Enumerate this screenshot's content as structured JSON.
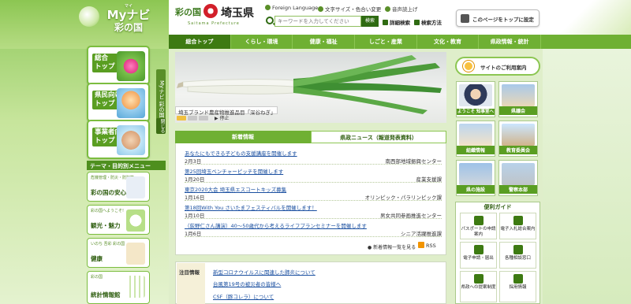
{
  "brand": {
    "mynavi_line1": "Myナビ",
    "mynavi_line2": "彩の国",
    "mynavi_ruby": "マイ",
    "pref_kanji": "彩の国",
    "pref_name": "埼玉県",
    "pref_sub": "Saitama Prefecture"
  },
  "header": {
    "foreign": "Foreign Language",
    "text_size": "文字サイズ・色合い変更",
    "voice": "音声読上げ",
    "search_placeholder": "キーワードを入力してください",
    "search_button": "検索",
    "detail_search": "詳細検索",
    "search_method": "検索方法",
    "set_top": "このページをトップに設定"
  },
  "main_nav": [
    {
      "label": "総合トップ",
      "active": true
    },
    {
      "label": "くらし・環境",
      "active": false
    },
    {
      "label": "健康・福祉",
      "active": false
    },
    {
      "label": "しごと・産業",
      "active": false
    },
    {
      "label": "文化・教育",
      "active": false
    },
    {
      "label": "県政情報・統計",
      "active": false
    }
  ],
  "left_nav": {
    "cards": [
      {
        "label": "総合\nトップ",
        "l1": "総合",
        "l2": "トップ"
      },
      {
        "label": "県民向け\nトップ",
        "l1": "県民向け",
        "l2": "トップ"
      },
      {
        "label": "事業者向け\nトップ",
        "l1": "事業者向け",
        "l2": "トップ"
      }
    ],
    "vertical": "Myナビ 彩の国",
    "close": "閉じる",
    "theme_header": "テーマ・目的別メニュー",
    "themes": [
      {
        "small": "危機管理・防災・防犯等",
        "big": "彩の国の安心・安全"
      },
      {
        "small": "彩の国へようこそ!",
        "big": "観光・魅力"
      },
      {
        "small": "いのち 吾彩 彩の国",
        "big": "健康"
      },
      {
        "small": "彩の国",
        "big": "統計情報館"
      }
    ]
  },
  "hero": {
    "caption": "埼玉ブランド農産物推進品目「深谷ねぎ」",
    "stop": "停止"
  },
  "news": {
    "tab_new": "新着情報",
    "tab_press": "県政ニュース（報道発表資料）",
    "items": [
      {
        "title": "あなたにもできる子どもの支援講座を開催します",
        "date": "2月3日",
        "dept": "南西部地域振興センター"
      },
      {
        "title": "第25回埼玉ベンチャーピッチを開催します",
        "date": "1月20日",
        "dept": "産業支援課"
      },
      {
        "title": "東京2020大会 埼玉県エスコートキッズ募集",
        "date": "1月16日",
        "dept": "オリンピック・パラリンピック課"
      },
      {
        "title": "第18回With You さいたまフェスティバルを開催します！",
        "date": "1月10日",
        "dept": "男女共同参画推進センター"
      },
      {
        "title": "（荻野仁さん講演）40～50歳代から考えるライフプランセミナーを開催します",
        "date": "1月6日",
        "dept": "シニア活躍推進課"
      }
    ],
    "more": "新着情報一覧を見る",
    "rss": "RSS"
  },
  "attention": {
    "label": "注目情報",
    "items": [
      "新型コロナウイルスに関連した肺炎について",
      "台風第19号の被災者の皆様へ",
      "CSF（豚コレラ）について"
    ]
  },
  "right": {
    "usage": "サイトのご利用案内",
    "tiles": [
      {
        "label": "ようこそ\n知事室へ"
      },
      {
        "label": "県議会"
      },
      {
        "label": "組織情報"
      },
      {
        "label": "教育委員会"
      },
      {
        "label": "県の施設"
      },
      {
        "label": "警察本部"
      }
    ],
    "guide_header": "便利ガイド",
    "guide": [
      "パスポートの申請案内",
      "電子入札総合案内",
      "電子申請・届出",
      "各種相談窓口",
      "県政への提案制度",
      "採用情報"
    ]
  },
  "colors": {
    "brand_green": "#6fb033",
    "dark_green": "#3d7a12",
    "link_blue": "#1a4fa0",
    "pref_red": "#d21f2a"
  }
}
